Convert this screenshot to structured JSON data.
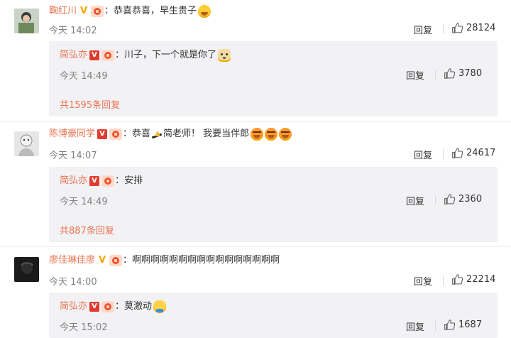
{
  "comments": [
    {
      "username": "鞠红川",
      "badge": "gold-v-badge",
      "text": "恭喜恭喜，早生贵子",
      "emoji": [
        "laughing-emoji"
      ],
      "time": "今天 14:02",
      "reply_label": "回复",
      "likes": "28124",
      "sub": {
        "username": "简弘亦",
        "text": "川子，下一个就是你了",
        "time": "今天 14:49",
        "reply_label": "回复",
        "likes": "3780"
      },
      "more_label": "共1595条回复"
    },
    {
      "username": "陈博豪同学",
      "badge": "red-v-badge",
      "text_before": "恭喜",
      "text_after": "简老师！ 我要当伴郎",
      "time": "今天 14:07",
      "reply_label": "回复",
      "likes": "24617",
      "sub": {
        "username": "简弘亦",
        "text": "安排",
        "time": "今天 14:49",
        "reply_label": "回复",
        "likes": "2360"
      },
      "more_label": "共887条回复"
    },
    {
      "username": "廖佳琳佳廖",
      "badge": "gold-v-badge",
      "text": "啊啊啊啊啊啊啊啊啊啊啊啊啊啊啊啊",
      "time": "今天 14:00",
      "reply_label": "回复",
      "likes": "22214",
      "sub": {
        "username": "简弘亦",
        "text": "莫激动",
        "time": "今天 15:02",
        "reply_label": "回复",
        "likes": "1687"
      }
    }
  ],
  "colors": {
    "username": "#eb7350",
    "text": "#333333",
    "time": "#808080",
    "sub_bg": "#f2f2f5"
  }
}
